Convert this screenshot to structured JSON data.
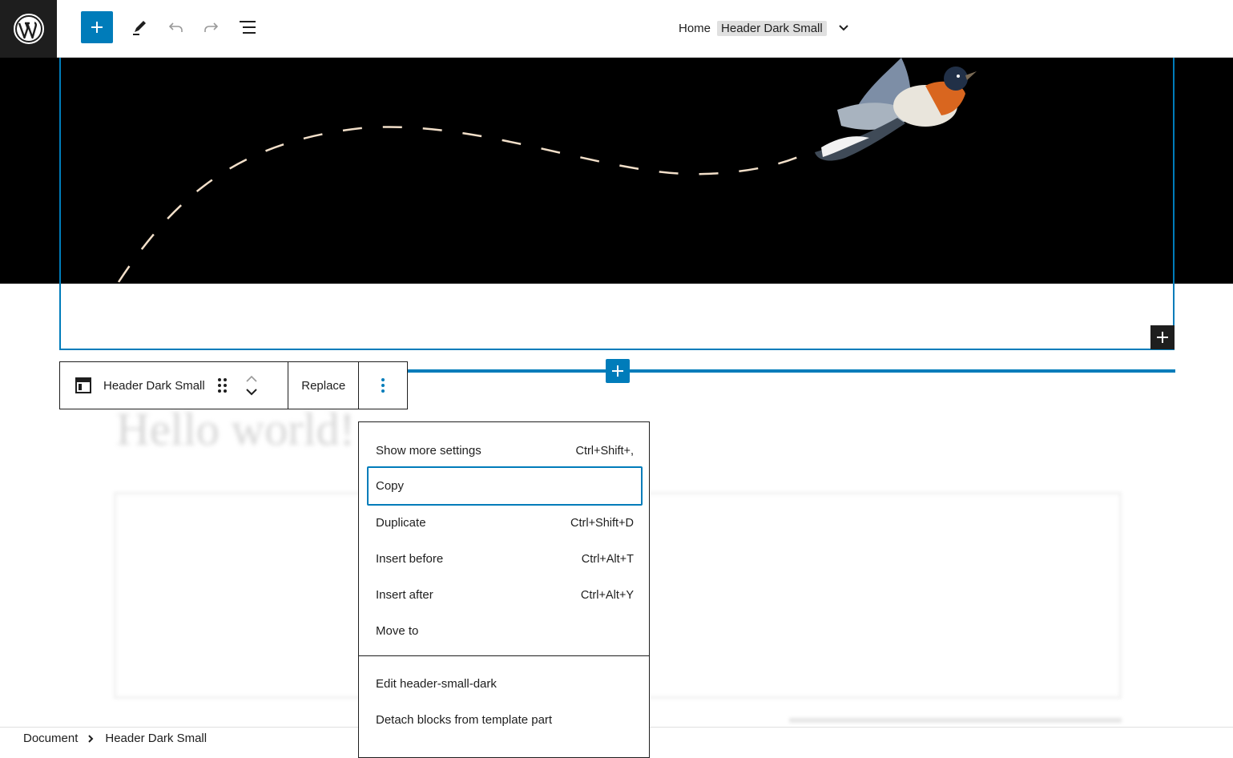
{
  "topbar": {
    "logo_icon": "wordpress-logo-icon",
    "tools": [
      {
        "name": "add-block-button",
        "icon": "plus-icon"
      },
      {
        "name": "edit-tool",
        "icon": "pencil-icon"
      },
      {
        "name": "undo-button",
        "icon": "undo-icon"
      },
      {
        "name": "redo-button",
        "icon": "redo-icon"
      },
      {
        "name": "list-view-button",
        "icon": "list-view-icon"
      }
    ],
    "document_title": {
      "home": "Home",
      "template_part": "Header Dark Small"
    }
  },
  "block_toolbar": {
    "block_label": "Header Dark Small",
    "replace_label": "Replace"
  },
  "options_menu": {
    "items": [
      {
        "label": "Show more settings",
        "shortcut": "Ctrl+Shift+,"
      },
      {
        "label": "Copy",
        "shortcut": ""
      },
      {
        "label": "Duplicate",
        "shortcut": "Ctrl+Shift+D"
      },
      {
        "label": "Insert before",
        "shortcut": "Ctrl+Alt+T"
      },
      {
        "label": "Insert after",
        "shortcut": "Ctrl+Alt+Y"
      },
      {
        "label": "Move to",
        "shortcut": ""
      },
      {
        "label": "Edit header-small-dark",
        "shortcut": ""
      },
      {
        "label": "Detach blocks from template part",
        "shortcut": ""
      }
    ]
  },
  "background": {
    "heading": "Hello world!"
  },
  "footer": {
    "breadcrumb": [
      "Document",
      "Header Dark Small"
    ]
  },
  "colors": {
    "accent": "#007cba",
    "dark": "#1e1e1e"
  }
}
